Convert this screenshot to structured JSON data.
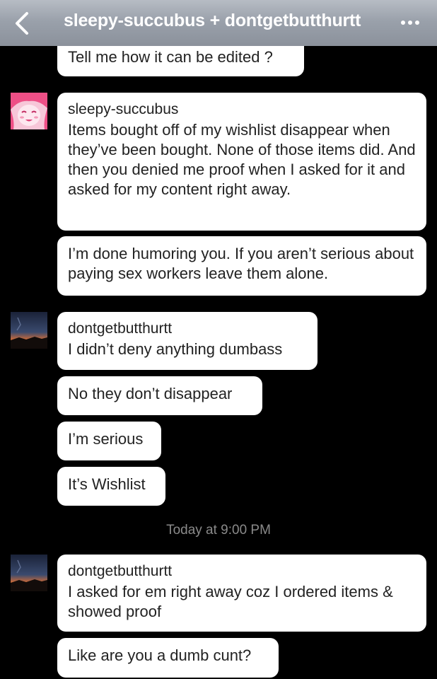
{
  "header": {
    "title": "sleepy-succubus + dontgetbutthurtt"
  },
  "conversation": {
    "timestamp": "Today at 9:00 PM",
    "messages": [
      {
        "text": "Tell me how it can be edited ?"
      },
      {
        "username": "sleepy-succubus",
        "text": "Items bought off of my wishlist disappear when they’ve been bought. None of those items did. And then you denied me proof when I asked for it and asked for my content right away."
      },
      {
        "text": "I’m done humoring you. If you aren’t serious about paying sex workers leave them alone."
      },
      {
        "username": "dontgetbutthurtt",
        "text": "I didn’t deny anything dumbass"
      },
      {
        "text": "No they don’t disappear"
      },
      {
        "text": "I’m serious"
      },
      {
        "text": "It’s Wishlist"
      },
      {
        "username": "dontgetbutthurtt",
        "text": "I asked for em right away coz I ordered items & showed proof"
      },
      {
        "text": "Like are you a dumb cunt?"
      }
    ]
  },
  "icons": {
    "back": "chevron-left-icon",
    "more": "more-horizontal-icon"
  },
  "colors": {
    "background": "#000000",
    "bubble": "#ffffff",
    "text": "#222222",
    "timestamp": "#8a8a8a",
    "header_text": "#ffffff"
  }
}
